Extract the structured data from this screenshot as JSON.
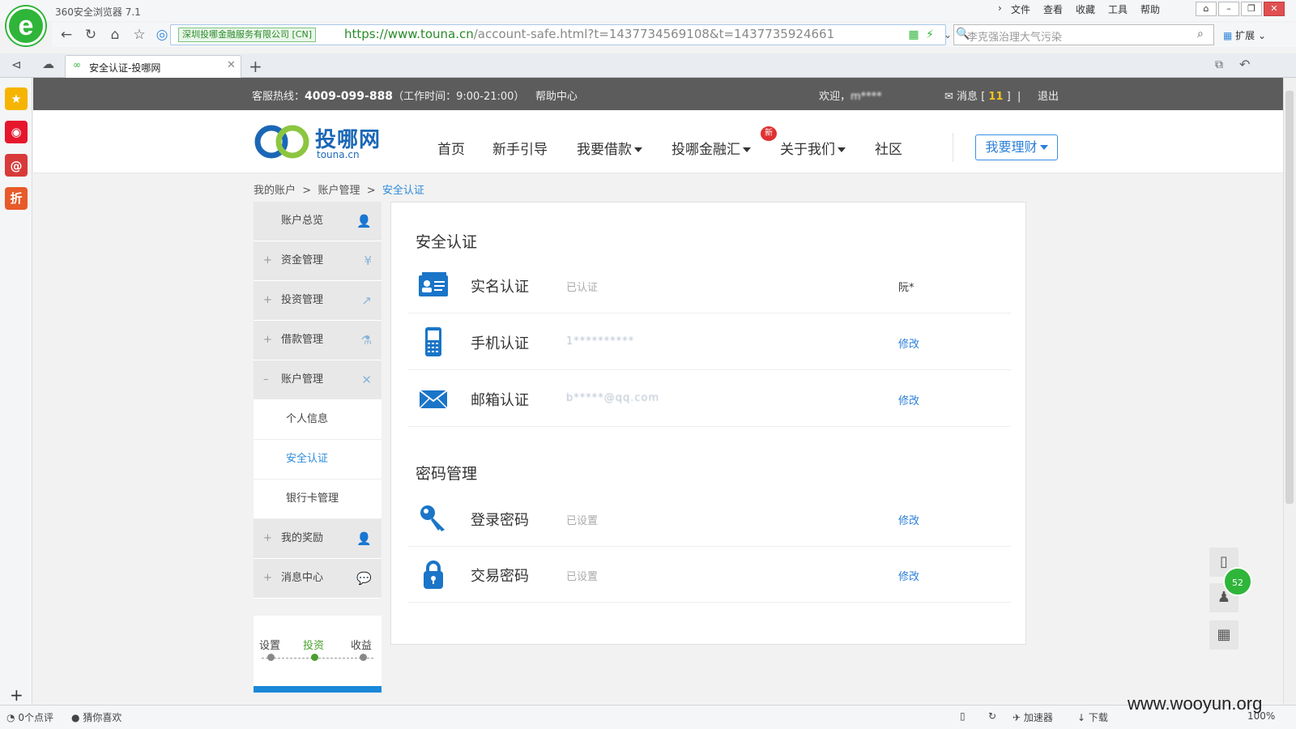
{
  "browser": {
    "app_title": "360安全浏览器 7.1",
    "logo_letter": "e",
    "menus": [
      "文件",
      "查看",
      "收藏",
      "工具",
      "帮助"
    ],
    "window_buttons": [
      "⌂",
      "–",
      "❐",
      "✕"
    ],
    "cert_label": "深圳投哪金融服务有限公司 [CN]",
    "url_host": "https://www.touna.cn",
    "url_path": "/account-safe.html?t=1437734569108&t=1437735924661",
    "search_placeholder": "李克强治理大气污染",
    "extension_label": "扩展",
    "tab_title": "安全认证-投哪网",
    "accent": "#2fb53a"
  },
  "rail_icons": [
    {
      "name": "favorites-icon",
      "glyph": "★",
      "color": "#f5b400"
    },
    {
      "name": "weibo-icon",
      "glyph": "◉",
      "color": "#e6162d"
    },
    {
      "name": "mail-icon",
      "glyph": "@",
      "color": "#d83a3a"
    },
    {
      "name": "discount-icon",
      "glyph": "折",
      "color": "#e85a2a"
    }
  ],
  "site": {
    "hotline_label": "客服热线：",
    "hotline_number": "4009-099-888",
    "hotline_hours": "（工作时间：9:00-21:00）",
    "help": "帮助中心",
    "welcome": "欢迎，",
    "welcome_user": "m****",
    "message_label": "消息",
    "message_count": "11",
    "logout": "退出",
    "brand_name": "投哪网",
    "brand_sub": "touna.cn",
    "nav": [
      "首页",
      "新手引导",
      "我要借款",
      "投哪金融汇",
      "关于我们",
      "社区"
    ],
    "new_badge": "新",
    "invest_button": "我要理财",
    "brand_color": "#1b67b6"
  },
  "breadcrumb": [
    "我的账户",
    "账户管理",
    "安全认证"
  ],
  "breadcrumb_sep": ">",
  "sidebar": {
    "items": [
      {
        "label": "账户总览",
        "prefix": "",
        "icon": "👤"
      },
      {
        "label": "资金管理",
        "prefix": "+",
        "icon": "¥"
      },
      {
        "label": "投资管理",
        "prefix": "+",
        "icon": "↗"
      },
      {
        "label": "借款管理",
        "prefix": "+",
        "icon": "⚗"
      },
      {
        "label": "账户管理",
        "prefix": "–",
        "icon": "✕"
      }
    ],
    "subitems": [
      "个人信息",
      "安全认证",
      "银行卡管理"
    ],
    "items_after": [
      {
        "label": "我的奖励",
        "prefix": "+",
        "icon": "👤"
      },
      {
        "label": "消息中心",
        "prefix": "+",
        "icon": "💬"
      }
    ]
  },
  "progress": {
    "steps": [
      "设置",
      "投资",
      "收益"
    ],
    "current": 1
  },
  "security": {
    "title": "安全认证",
    "rows": [
      {
        "name": "实名认证",
        "status": "已认证",
        "action": "阮*",
        "action_link": false,
        "icon": "id-card-icon"
      },
      {
        "name": "手机认证",
        "status": "1**********",
        "action": "修改",
        "action_link": true,
        "icon": "phone-icon"
      },
      {
        "name": "邮箱认证",
        "status": "b*****@qq.com",
        "action": "修改",
        "action_link": true,
        "icon": "envelope-icon"
      }
    ]
  },
  "password": {
    "title": "密码管理",
    "rows": [
      {
        "name": "登录密码",
        "status": "已设置",
        "action": "修改",
        "icon": "key-icon"
      },
      {
        "name": "交易密码",
        "status": "已设置",
        "action": "修改",
        "icon": "lock-icon"
      }
    ]
  },
  "floaters": [
    "mobile-app-icon",
    "qq-icon",
    "qrcode-icon"
  ],
  "green_ball": "52",
  "statusbar": {
    "left": [
      "0个点评",
      "猜你喜欢"
    ],
    "right": [
      "加速器",
      "下载",
      "100%"
    ]
  },
  "watermark": "www.wooyun.org"
}
